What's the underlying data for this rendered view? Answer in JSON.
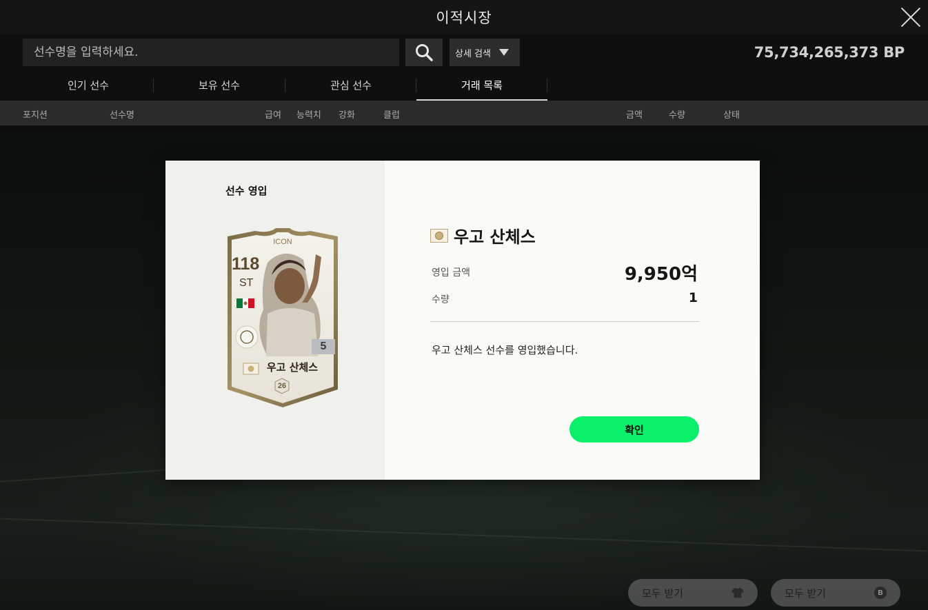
{
  "header": {
    "title": "이적시장"
  },
  "search": {
    "placeholder": "선수명을 입력하세요.",
    "detail_label": "상세 검색"
  },
  "balance": {
    "text": "75,734,265,373 BP"
  },
  "tabs": [
    {
      "label": "인기 선수"
    },
    {
      "label": "보유 선수"
    },
    {
      "label": "관심 선수"
    },
    {
      "label": "거래 목록",
      "active": true
    }
  ],
  "columns": {
    "position": "포지션",
    "name": "선수명",
    "salary": "급여",
    "ability": "능력치",
    "enhance": "강화",
    "club": "클럽",
    "amount": "금액",
    "quantity": "수량",
    "status": "상태"
  },
  "modal": {
    "title": "선수 영입",
    "card": {
      "label": "ICON",
      "ovr": "118",
      "position": "ST",
      "level": "5",
      "name": "우고 산체스",
      "salary": "26",
      "flag": "mexico-flag"
    },
    "player_name": "우고 산체스",
    "price_label": "영입 금액",
    "price_value": "9,950억",
    "qty_label": "수량",
    "qty_value": "1",
    "message": "우고 산체스 선수를 영입했습니다.",
    "confirm": "확인"
  },
  "footer": {
    "receive_all_items": "모두 받기",
    "receive_all_bp": "모두 받기"
  },
  "colors": {
    "accent": "#0bf06a",
    "modal_bg": "#fafaf6",
    "modal_left_bg": "#f0f0ed"
  }
}
